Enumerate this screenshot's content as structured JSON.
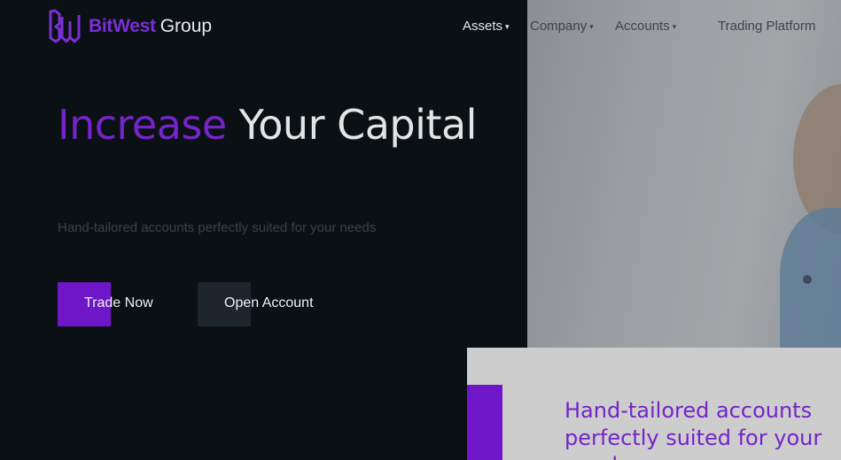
{
  "brand": {
    "name_bold": "BitWest",
    "name_light": "Group",
    "logo_icon": "bw-monogram-icon",
    "accent_color": "#6e16c8"
  },
  "nav": {
    "assets": "Assets",
    "company": "Company",
    "accounts": "Accounts",
    "trading_platform": "Trading Platform",
    "caret_icon": "chevron-down-icon"
  },
  "hero": {
    "title_accent": "Increase",
    "title_rest": "Your Capital",
    "subtitle": "Hand-tailored accounts perfectly suited for your needs",
    "trade_button": "Trade Now",
    "open_button": "Open Account"
  },
  "card": {
    "text": "Hand-tailored accounts perfectly suited for your needs"
  }
}
